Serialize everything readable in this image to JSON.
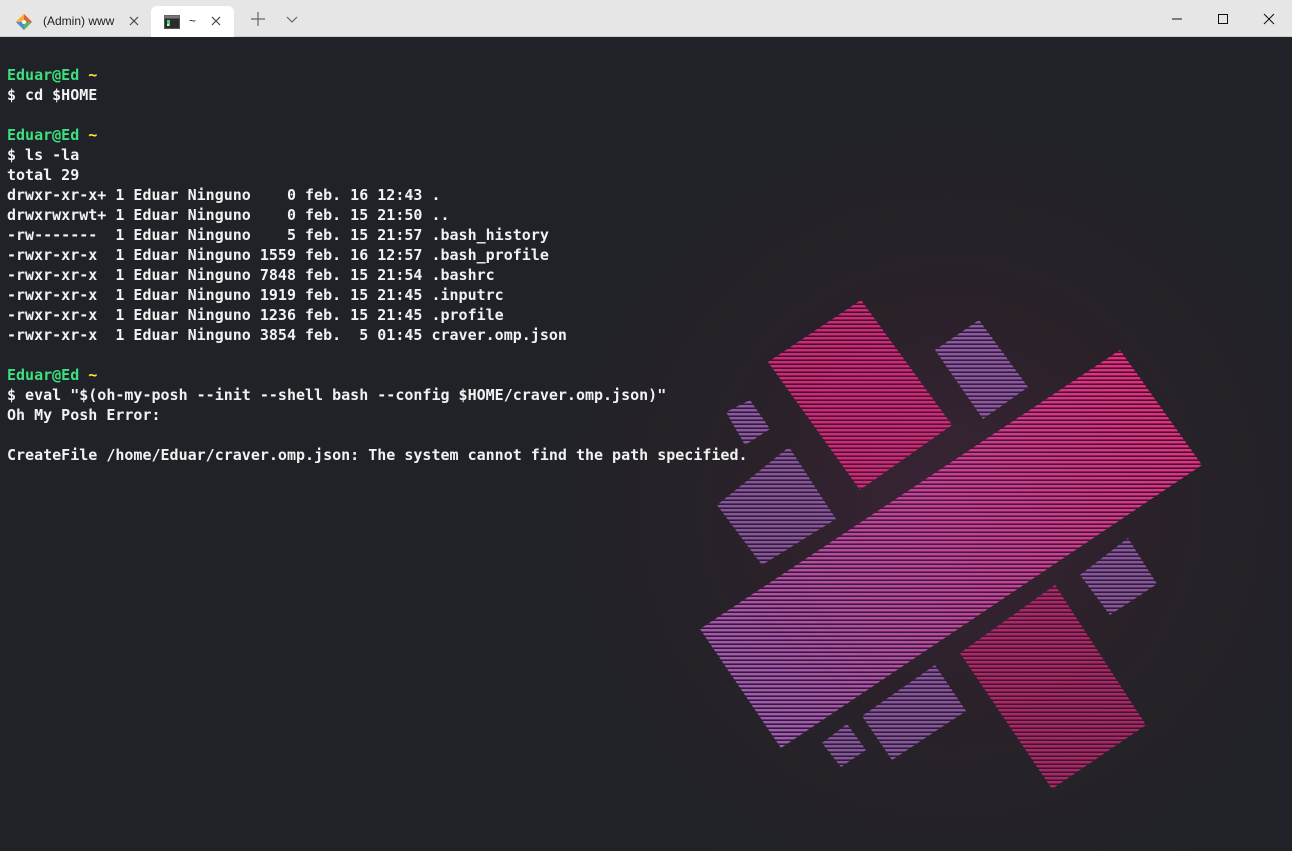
{
  "tabs": [
    {
      "label": "(Admin) www",
      "icon": "git-icon",
      "active": false
    },
    {
      "label": "~",
      "icon": "terminal-icon",
      "active": true
    }
  ],
  "colors": {
    "prompt_user": "#3fdf7f",
    "prompt_path": "#ffe43b",
    "text": "#f2f2f2",
    "background": "#1f2328",
    "accent_pink": "#e61f7f",
    "accent_purple": "#8a4fa8"
  },
  "terminal": {
    "lines": [
      {
        "user": "Eduar@Ed",
        "path": "~"
      },
      {
        "text": "$ cd $HOME"
      },
      {
        "text": ""
      },
      {
        "user": "Eduar@Ed",
        "path": "~"
      },
      {
        "text": "$ ls -la"
      },
      {
        "text": "total 29"
      },
      {
        "text": "drwxr-xr-x+ 1 Eduar Ninguno    0 feb. 16 12:43 ."
      },
      {
        "text": "drwxrwxrwt+ 1 Eduar Ninguno    0 feb. 15 21:50 .."
      },
      {
        "text": "-rw-------  1 Eduar Ninguno    5 feb. 15 21:57 .bash_history"
      },
      {
        "text": "-rwxr-xr-x  1 Eduar Ninguno 1559 feb. 16 12:57 .bash_profile"
      },
      {
        "text": "-rwxr-xr-x  1 Eduar Ninguno 7848 feb. 15 21:54 .bashrc"
      },
      {
        "text": "-rwxr-xr-x  1 Eduar Ninguno 1919 feb. 15 21:45 .inputrc"
      },
      {
        "text": "-rwxr-xr-x  1 Eduar Ninguno 1236 feb. 15 21:45 .profile"
      },
      {
        "text": "-rwxr-xr-x  1 Eduar Ninguno 3854 feb.  5 01:45 craver.omp.json"
      },
      {
        "text": ""
      },
      {
        "user": "Eduar@Ed",
        "path": "~"
      },
      {
        "text": "$ eval \"$(oh-my-posh --init --shell bash --config $HOME/craver.omp.json)\""
      },
      {
        "text": "Oh My Posh Error:"
      },
      {
        "text": ""
      },
      {
        "text": "CreateFile /home/Eduar/craver.omp.json: The system cannot find the path specified."
      }
    ]
  }
}
